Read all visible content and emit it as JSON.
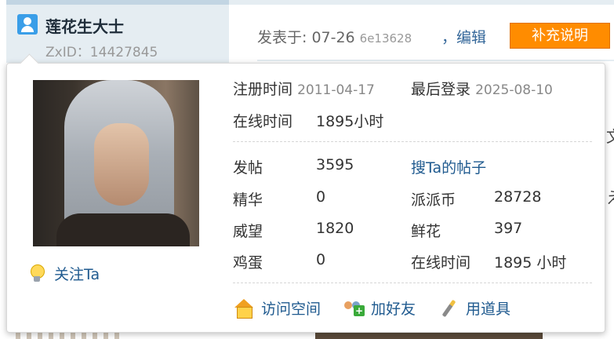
{
  "post_header": {
    "author_name": "莲花生大士",
    "author_id": "ZxID：14427845",
    "post_time": "发表于: 07-26",
    "post_hash": "6e13628",
    "edit_link": "，编辑",
    "supplement_button": "补充说明"
  },
  "background_text": [
    "文",
    "え"
  ],
  "card": {
    "follow_label": "关注Ta",
    "register": {
      "label": "注册时间",
      "value": "2011-04-17"
    },
    "last_login": {
      "label": "最后登录",
      "value": "2025-08-10"
    },
    "online_time_top": {
      "label": "在线时间",
      "value": "1895小时"
    },
    "posts": {
      "label": "发帖",
      "value": "3595"
    },
    "search_posts_link": "搜Ta的帖子",
    "elite": {
      "label": "精华",
      "value": "0"
    },
    "coins": {
      "label": "派派币",
      "value": "28728"
    },
    "prestige": {
      "label": "威望",
      "value": "1820"
    },
    "flowers": {
      "label": "鲜花",
      "value": "397"
    },
    "eggs": {
      "label": "鸡蛋",
      "value": "0"
    },
    "online_time_bottom": {
      "label": "在线时间",
      "value": "1895 小时"
    },
    "actions": [
      {
        "icon": "house-icon",
        "label": "访问空间"
      },
      {
        "icon": "add-friend-icon",
        "label": "加好友"
      },
      {
        "icon": "magic-wand-icon",
        "label": "用道具"
      }
    ]
  },
  "colors": {
    "link": "#1f5a8f",
    "supplement_button_bg": "#ff8c00",
    "header_bg": "#e5edf2"
  }
}
